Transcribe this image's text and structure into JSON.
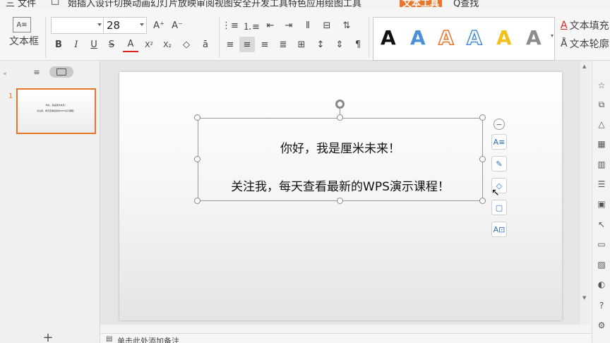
{
  "menubar": {
    "tabs": [
      "三 文件",
      "□",
      "始插入设计切换动画幻灯片放映审阅视图安全开发工具特色应用绘图工具"
    ],
    "active_tab": "文本工具",
    "search": "Q查找"
  },
  "ribbon": {
    "textbox_label": "文本框",
    "font_family": "",
    "font_size": "28",
    "grow_font": "A⁺",
    "shrink_font": "A⁻",
    "bold": "B",
    "italic": "I",
    "underline": "U",
    "strike": "S",
    "font_color": "A",
    "superscript": "X²",
    "subscript": "X₂",
    "clear": "◇",
    "text_fill": "文本填充",
    "text_outline": "文本轮廓",
    "style_letters": [
      "A",
      "A",
      "A",
      "A",
      "A",
      "A"
    ],
    "style_colors": [
      "#111111",
      "#4a8fd8",
      "#e8762b",
      "#ffffff",
      "#f2c21b",
      "#8c8c8c"
    ]
  },
  "slide": {
    "number": "1",
    "line1": "你好，我是厘米未来！",
    "line2": "关注我，每天查看最新的WPS演示课程！",
    "thumb_line1": "你好，我是厘米未来！",
    "thumb_line2": "关注我，每天查看最新的WPS演示课程！"
  },
  "notes": {
    "placeholder": "单击此处添加备注"
  },
  "colors": {
    "accent": "#e8762b",
    "tool_blue": "#2f6fbf"
  }
}
